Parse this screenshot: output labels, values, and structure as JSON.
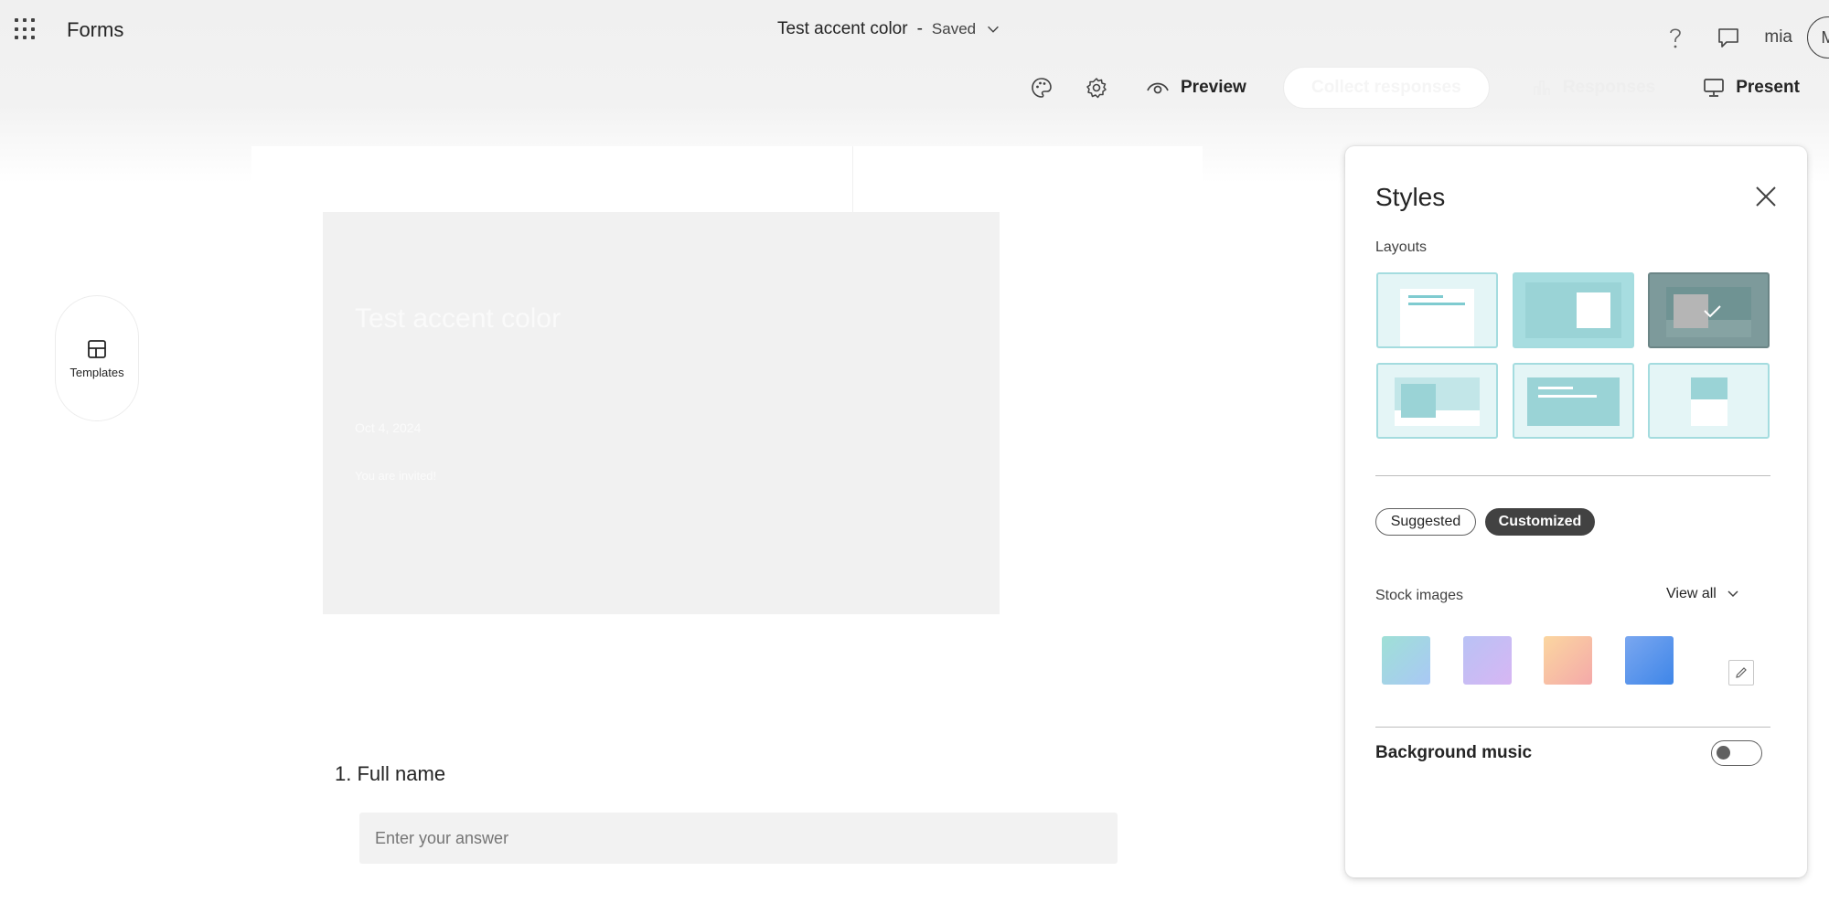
{
  "app": {
    "name": "Forms"
  },
  "header": {
    "form_title": "Test accent color",
    "separator": "-",
    "save_status": "Saved",
    "user_name": "mia",
    "avatar_initial": "M"
  },
  "toolbar": {
    "preview_label": "Preview",
    "collect_label": "Collect responses",
    "responses_label": "Responses",
    "present_label": "Present"
  },
  "side": {
    "templates_label": "Templates"
  },
  "form": {
    "banner_title": "Test accent color",
    "banner_date": "Oct 4, 2024",
    "banner_subtitle": "You are invited!",
    "questions": [
      {
        "number": "1.",
        "title": "Full name",
        "placeholder": "Enter your answer"
      }
    ]
  },
  "styles_panel": {
    "title": "Styles",
    "layouts_label": "Layouts",
    "tabs": {
      "suggested": "Suggested",
      "customized": "Customized",
      "active": "Customized"
    },
    "stock_images_label": "Stock images",
    "view_all_label": "View all",
    "background_music_label": "Background music",
    "background_music_on": false,
    "swatch_colors": [
      [
        "#9fe0d6",
        "#a9c8f5"
      ],
      [
        "#b9c2f5",
        "#d7b6f3"
      ],
      [
        "#fbd6a0",
        "#f4a9a9"
      ],
      [
        "#7aa7f0",
        "#3f86e8"
      ]
    ]
  },
  "icons": {
    "waffle": "app-launcher-icon",
    "help": "help-icon",
    "comment": "comment-icon",
    "palette": "palette-icon",
    "settings": "gear-icon",
    "preview": "eye-icon",
    "present": "monitor-icon",
    "more": "more-icon",
    "close": "close-icon",
    "edit": "pencil-icon"
  }
}
